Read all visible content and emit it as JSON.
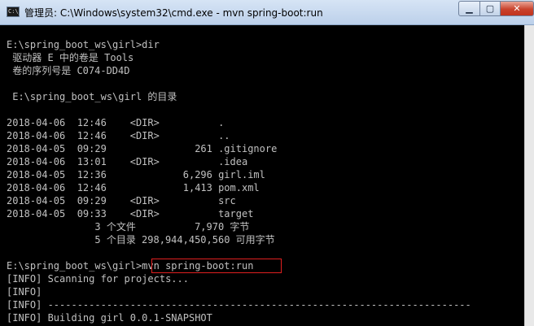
{
  "titlebar": {
    "icon_text": "C:\\_",
    "title": "管理员: C:\\Windows\\system32\\cmd.exe - mvn  spring-boot:run",
    "minimize": "▁",
    "maximize": "▢",
    "close": "✕"
  },
  "console": {
    "lines": [
      "E:\\spring_boot_ws\\girl>dir",
      " 驱动器 E 中的卷是 Tools",
      " 卷的序列号是 C074-DD4D",
      "",
      " E:\\spring_boot_ws\\girl 的目录",
      "",
      "2018-04-06  12:46    <DIR>          .",
      "2018-04-06  12:46    <DIR>          ..",
      "2018-04-05  09:29               261 .gitignore",
      "2018-04-06  13:01    <DIR>          .idea",
      "2018-04-05  12:36             6,296 girl.iml",
      "2018-04-06  12:46             1,413 pom.xml",
      "2018-04-05  09:29    <DIR>          src",
      "2018-04-05  09:33    <DIR>          target",
      "               3 个文件          7,970 字节",
      "               5 个目录 298,944,450,560 可用字节",
      "",
      "E:\\spring_boot_ws\\girl>mvn spring-boot:run",
      "[INFO] Scanning for projects...",
      "[INFO]",
      "[INFO] ------------------------------------------------------------------------",
      "[INFO] Building girl 0.0.1-SNAPSHOT"
    ]
  }
}
